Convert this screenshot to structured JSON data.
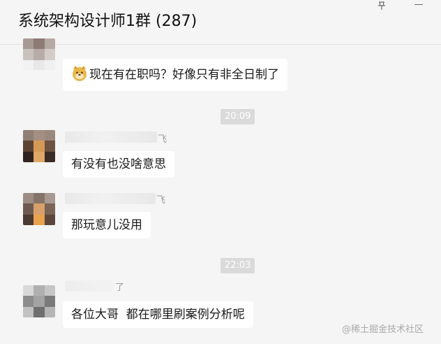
{
  "header": {
    "title": "系统架构设计师1群 (287)"
  },
  "messages": [
    {
      "text": "现在有在职吗？好像只有非全日制了",
      "emoji": "doge-emoji"
    },
    {
      "name_suffix": "飞",
      "text": "有没有也没啥意思"
    },
    {
      "name_suffix": "飞",
      "text": "那玩意儿没用"
    },
    {
      "name_suffix": "了",
      "text": "各位大哥  都在哪里刷案例分析呢"
    }
  ],
  "timestamps": [
    "20:09",
    "22:03"
  ],
  "watermark": "@稀土掘金技术社区",
  "icons": {
    "pin": "pin-icon",
    "minimize": "minimize-icon"
  }
}
